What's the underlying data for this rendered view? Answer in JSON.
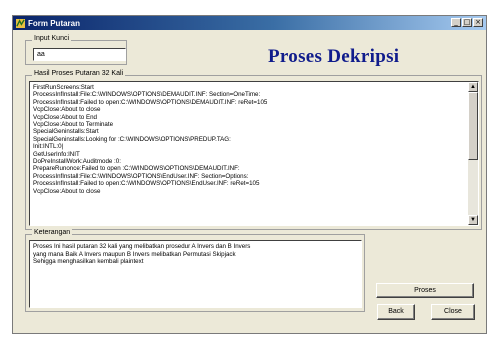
{
  "window": {
    "title": "Form Putaran",
    "minimize_symbol": "_",
    "maximize_symbol": "□",
    "close_symbol": "×"
  },
  "input_group": {
    "label": "Input Kunci",
    "value": "aa"
  },
  "heading": "Proses Dekripsi",
  "log_group": {
    "label": "Hasil Proses Putaran 32 Kali",
    "lines": [
      "FirstRunScreens:Start",
      "ProcessInfInstall:File:C:\\WINDOWS\\OPTIONS\\DEMAUDIT.INF: Section=OneTime:",
      "ProcessInfInstall:Failed to open:C:\\WINDOWS\\OPTIONS\\DEMAUDIT.INF: reRet=105",
      "VcpClose:About to close",
      "VcpClose:About to End",
      "VcpClose:About to Terminate",
      "SpecialGeninstalls:Start",
      "SpecialGeninstalls:Looking for :C:\\WINDOWS\\OPTIONS\\PREDUP.TAG:",
      "Init:INTL:0|",
      "GetUserInfo:INIT",
      "DoPreInstallWork:Auditmode :0:",
      "PrepareRunonce:Failed to open :C:\\WINDOWS\\OPTIONS\\DEMAUDIT.INF:",
      "ProcessInfInstall:File:C:\\WINDOWS\\OPTIONS\\EndUser.INF: Section=Options:",
      "ProcessInfInstall:Failed to open:C:\\WINDOWS\\OPTIONS\\EndUser.INF: reRet=105",
      "VcpClose:About to close"
    ],
    "scroll_up": "▲",
    "scroll_down": "▼"
  },
  "notes_group": {
    "label": "Keterangan",
    "lines": [
      "Proses Ini hasil putaran 32 kali yang melibatkan prosedur A Invers dan B Invers",
      "yang mana Baik A Invers maupun B Invers melibatkan Permutasi Skipjack",
      "Sehigga menghasilkan kembali plaintext"
    ]
  },
  "buttons": {
    "proses": "Proses",
    "back": "Back",
    "close": "Close"
  },
  "colors": {
    "titlebar_start": "#0a246a",
    "heading": "#101c8c",
    "window_bg": "#ece9d8"
  },
  "icons": {
    "app": "app-icon"
  }
}
